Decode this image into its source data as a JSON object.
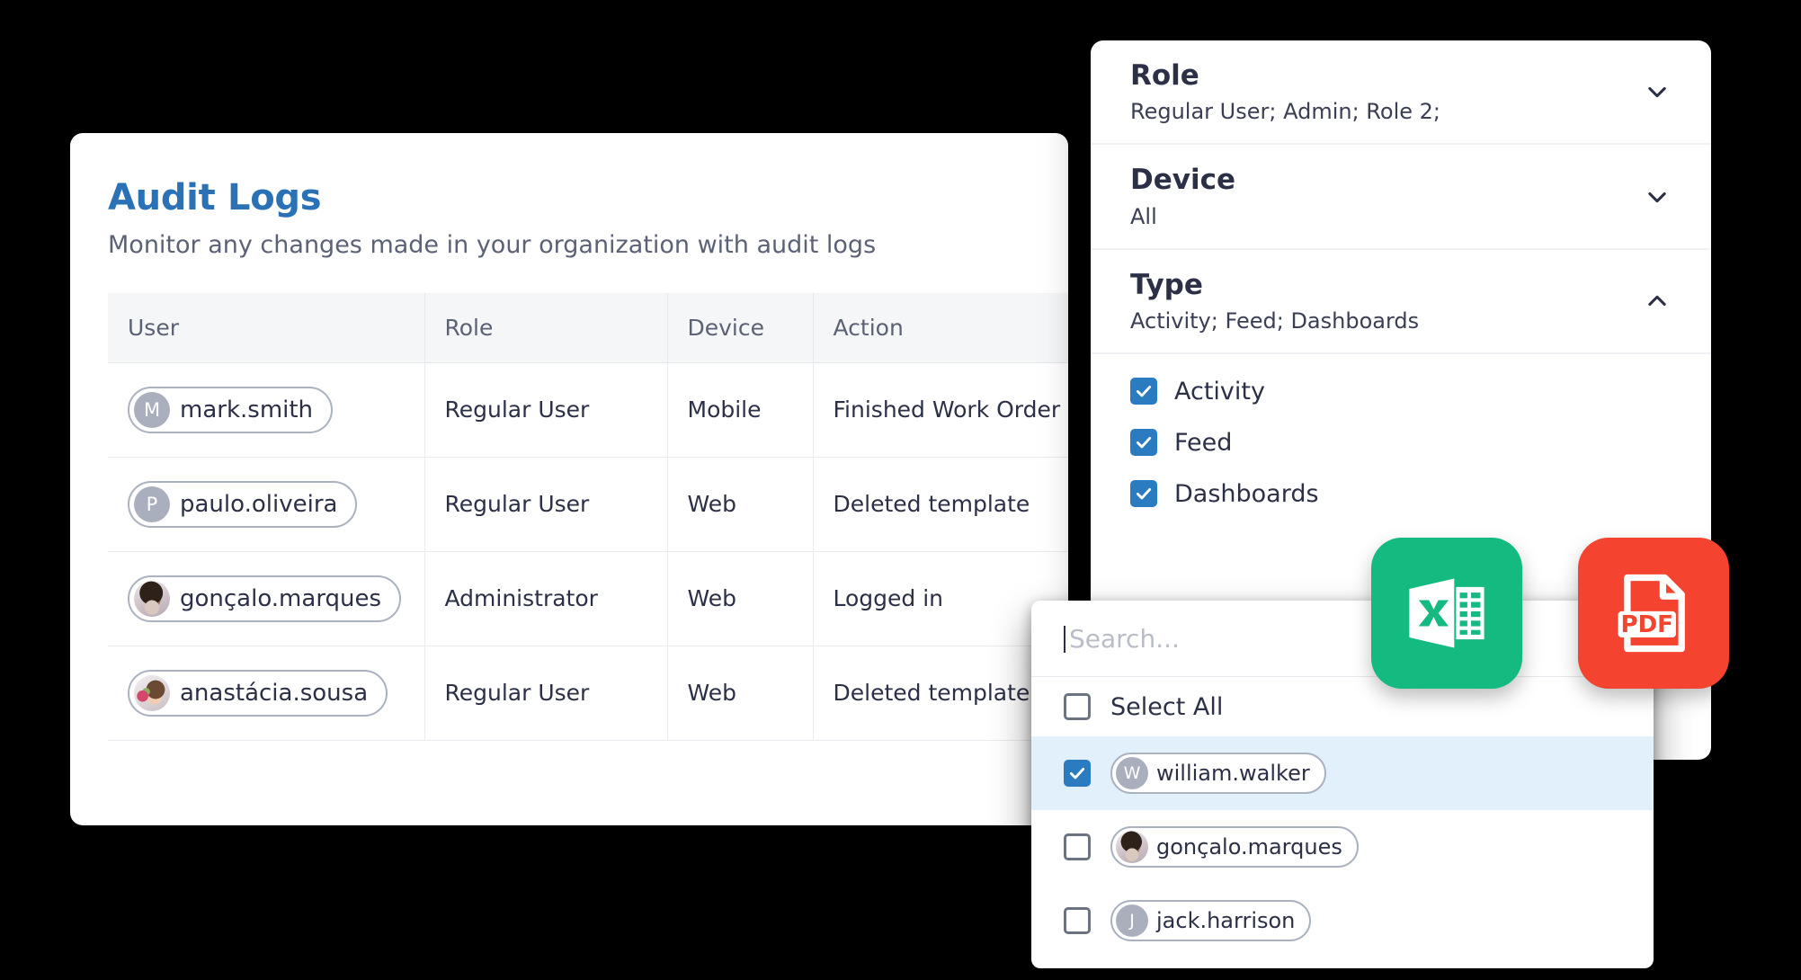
{
  "audit": {
    "title": "Audit Logs",
    "subtitle": "Monitor any changes made in your organization with audit logs",
    "columns": [
      "User",
      "Role",
      "Device",
      "Action"
    ],
    "rows": [
      {
        "user": "mark.smith",
        "avatar_kind": "initial",
        "avatar_letter": "M",
        "role": "Regular User",
        "device": "Mobile",
        "action": "Finished Work Order"
      },
      {
        "user": "paulo.oliveira",
        "avatar_kind": "initial",
        "avatar_letter": "P",
        "role": "Regular User",
        "device": "Web",
        "action": "Deleted template"
      },
      {
        "user": "gonçalo.marques",
        "avatar_kind": "photo",
        "avatar_letter": "",
        "role": "Administrator",
        "device": "Web",
        "action": "Logged in"
      },
      {
        "user": "anastácia.sousa",
        "avatar_kind": "photo",
        "avatar_letter": "",
        "role": "Regular User",
        "device": "Web",
        "action": "Deleted template"
      }
    ]
  },
  "filters": {
    "sections": [
      {
        "title": "Role",
        "value": "Regular User; Admin; Role 2;",
        "caret": "chevron-down-icon",
        "expanded": false
      },
      {
        "title": "Device",
        "value": "All",
        "caret": "chevron-down-icon",
        "expanded": false
      },
      {
        "title": "Type",
        "value": "Activity; Feed; Dashboards",
        "caret": "chevron-up-icon",
        "expanded": true
      }
    ],
    "type_options": [
      {
        "label": "Activity",
        "checked": true
      },
      {
        "label": "Feed",
        "checked": true
      },
      {
        "label": "Dashboards",
        "checked": true
      }
    ]
  },
  "user_dropdown": {
    "search_placeholder": "Search...",
    "search_value": "",
    "select_all_label": "Select All",
    "select_all_checked": false,
    "items": [
      {
        "name": "william.walker",
        "avatar_kind": "initial",
        "avatar_letter": "W",
        "checked": true,
        "highlighted": true
      },
      {
        "name": "gonçalo.marques",
        "avatar_kind": "photo",
        "avatar_letter": "",
        "checked": false,
        "highlighted": false
      },
      {
        "name": "jack.harrison",
        "avatar_kind": "initial",
        "avatar_letter": "J",
        "checked": false,
        "highlighted": false
      }
    ]
  },
  "export": {
    "excel": {
      "icon": "excel-file-icon",
      "label": "X",
      "color": "#14ba7f"
    },
    "pdf": {
      "icon": "pdf-file-icon",
      "label": "PDF",
      "color": "#f4432f"
    }
  },
  "colors": {
    "title_blue": "#2a72b5",
    "checkbox_blue": "#2b7bc0",
    "row_highlight": "#e2f0fb",
    "excel_green": "#14ba7f",
    "pdf_red": "#f4432f",
    "background": "#000000"
  }
}
